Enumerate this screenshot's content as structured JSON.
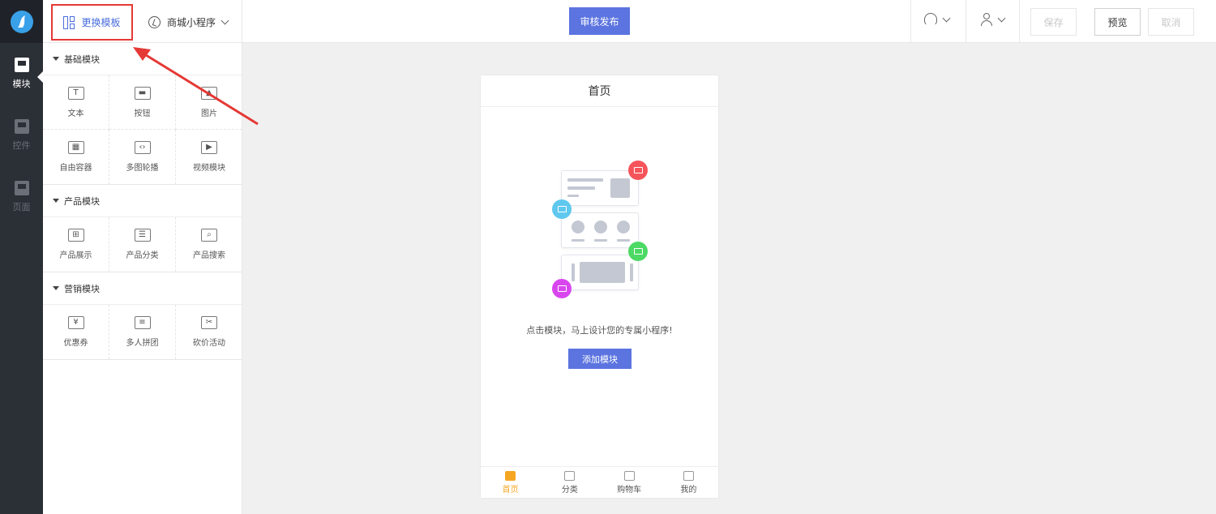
{
  "topbar": {
    "template_label": "更换模板",
    "app_name": "商城小程序",
    "publish_label": "审核发布",
    "save_label": "保存",
    "preview_label": "预览",
    "cancel_label": "取消"
  },
  "rail": {
    "items": [
      {
        "label": "模块",
        "icon": "module-icon",
        "active": true
      },
      {
        "label": "控件",
        "icon": "widget-icon",
        "active": false
      },
      {
        "label": "页面",
        "icon": "page-icon",
        "active": false
      }
    ]
  },
  "panel": {
    "sections": [
      {
        "title": "基础模块",
        "items": [
          {
            "label": "文本",
            "icon": "text-icon"
          },
          {
            "label": "按钮",
            "icon": "button-icon"
          },
          {
            "label": "图片",
            "icon": "image-icon"
          },
          {
            "label": "自由容器",
            "icon": "container-icon"
          },
          {
            "label": "多图轮播",
            "icon": "carousel-icon"
          },
          {
            "label": "视频模块",
            "icon": "video-icon"
          }
        ]
      },
      {
        "title": "产品模块",
        "items": [
          {
            "label": "产品展示",
            "icon": "product-grid-icon"
          },
          {
            "label": "产品分类",
            "icon": "product-list-icon"
          },
          {
            "label": "产品搜索",
            "icon": "product-search-icon"
          }
        ]
      },
      {
        "title": "营销模块",
        "items": [
          {
            "label": "优惠券",
            "icon": "coupon-icon"
          },
          {
            "label": "多人拼团",
            "icon": "group-buy-icon"
          },
          {
            "label": "砍价活动",
            "icon": "bargain-icon"
          }
        ]
      }
    ]
  },
  "phone": {
    "title": "首页",
    "empty_text": "点击模块，马上设计您的专属小程序!",
    "add_label": "添加模块",
    "tabs": [
      {
        "label": "首页",
        "active": true
      },
      {
        "label": "分类",
        "active": false
      },
      {
        "label": "购物车",
        "active": false
      },
      {
        "label": "我的",
        "active": false
      }
    ]
  },
  "colors": {
    "accent": "#5b74e0",
    "highlight_border": "#e53935",
    "tab_active": "#f5a623",
    "badge_red": "#f5545a",
    "badge_blue": "#5fc8ee",
    "badge_green": "#4cd964",
    "badge_purple": "#d946ef"
  }
}
